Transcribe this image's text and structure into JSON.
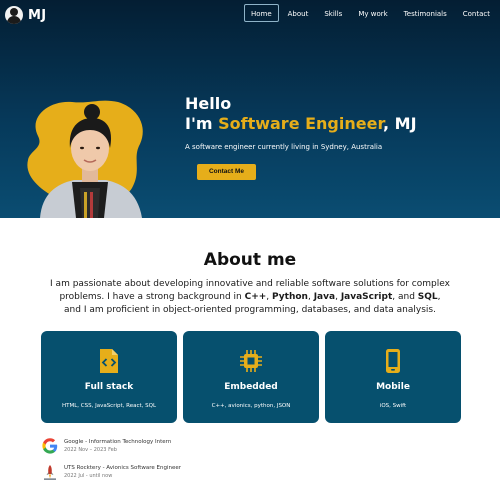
{
  "brand": {
    "name": "MJ"
  },
  "nav": {
    "items": [
      {
        "label": "Home",
        "active": true
      },
      {
        "label": "About",
        "active": false
      },
      {
        "label": "Skills",
        "active": false
      },
      {
        "label": "My work",
        "active": false
      },
      {
        "label": "Testimonials",
        "active": false
      },
      {
        "label": "Contact",
        "active": false
      }
    ]
  },
  "hero": {
    "greeting": "Hello",
    "headline_prefix": "I'm ",
    "headline_accent": "Software Engineer",
    "headline_suffix": ", MJ",
    "tagline": "A software engineer currently living in Sydney, Australia",
    "cta_label": "Contact Me",
    "accent_color": "#e6ae1a",
    "background_color": "#06395a"
  },
  "about": {
    "title": "About me",
    "text_1": "I am passionate about developing innovative and reliable software solutions for complex problems. I have a strong background in ",
    "skill_1": "C++",
    "sep_1": ", ",
    "skill_2": "Python",
    "sep_2": ", ",
    "skill_3": "Java",
    "sep_3": ", ",
    "skill_4": "JavaScript",
    "sep_4": ", and ",
    "skill_5": "SQL",
    "text_2": ", and I am proficient in object-oriented programming, databases, and data analysis."
  },
  "cards": [
    {
      "title": "Full stack",
      "subtitle": "HTML, CSS, JavaScript, React, SQL",
      "icon": "code-file-icon"
    },
    {
      "title": "Embedded",
      "subtitle": "C++, avionics, python, JSON",
      "icon": "chip-icon"
    },
    {
      "title": "Mobile",
      "subtitle": "iOS, Swift",
      "icon": "phone-icon"
    }
  ],
  "card_color": "#06506e",
  "experience": [
    {
      "title": "Google - Information Technology Intern",
      "date": "2022 Nov – 2023 Feb",
      "icon": "google-logo-icon"
    },
    {
      "title": "UTS Rocktery - Avionics Software Engineer",
      "date": "2022 Jul - until now",
      "icon": "rocket-logo-icon"
    }
  ]
}
